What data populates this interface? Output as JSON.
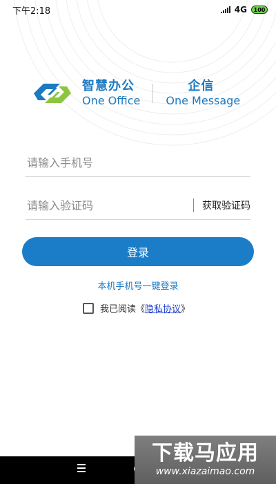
{
  "status_bar": {
    "time": "下午2:18",
    "network": "4G",
    "battery": "100"
  },
  "brand": {
    "left_cn": "智慧办公",
    "left_en": "One Office",
    "right_cn": "企信",
    "right_en": "One Message"
  },
  "form": {
    "phone_placeholder": "请输入手机号",
    "code_placeholder": "请输入验证码",
    "get_code_label": "获取验证码"
  },
  "login_button_label": "登录",
  "onekey_login_label": "本机手机号一键登录",
  "agreement": {
    "prefix": "我已阅读《",
    "link": "隐私协议",
    "suffix": "》"
  },
  "watermark": {
    "title": "下载马应用",
    "url": "www.xiazaimao.com"
  },
  "colors": {
    "accent": "#1b7dc8",
    "link": "#1f3fd0",
    "logo_green": "#8cc63e"
  }
}
